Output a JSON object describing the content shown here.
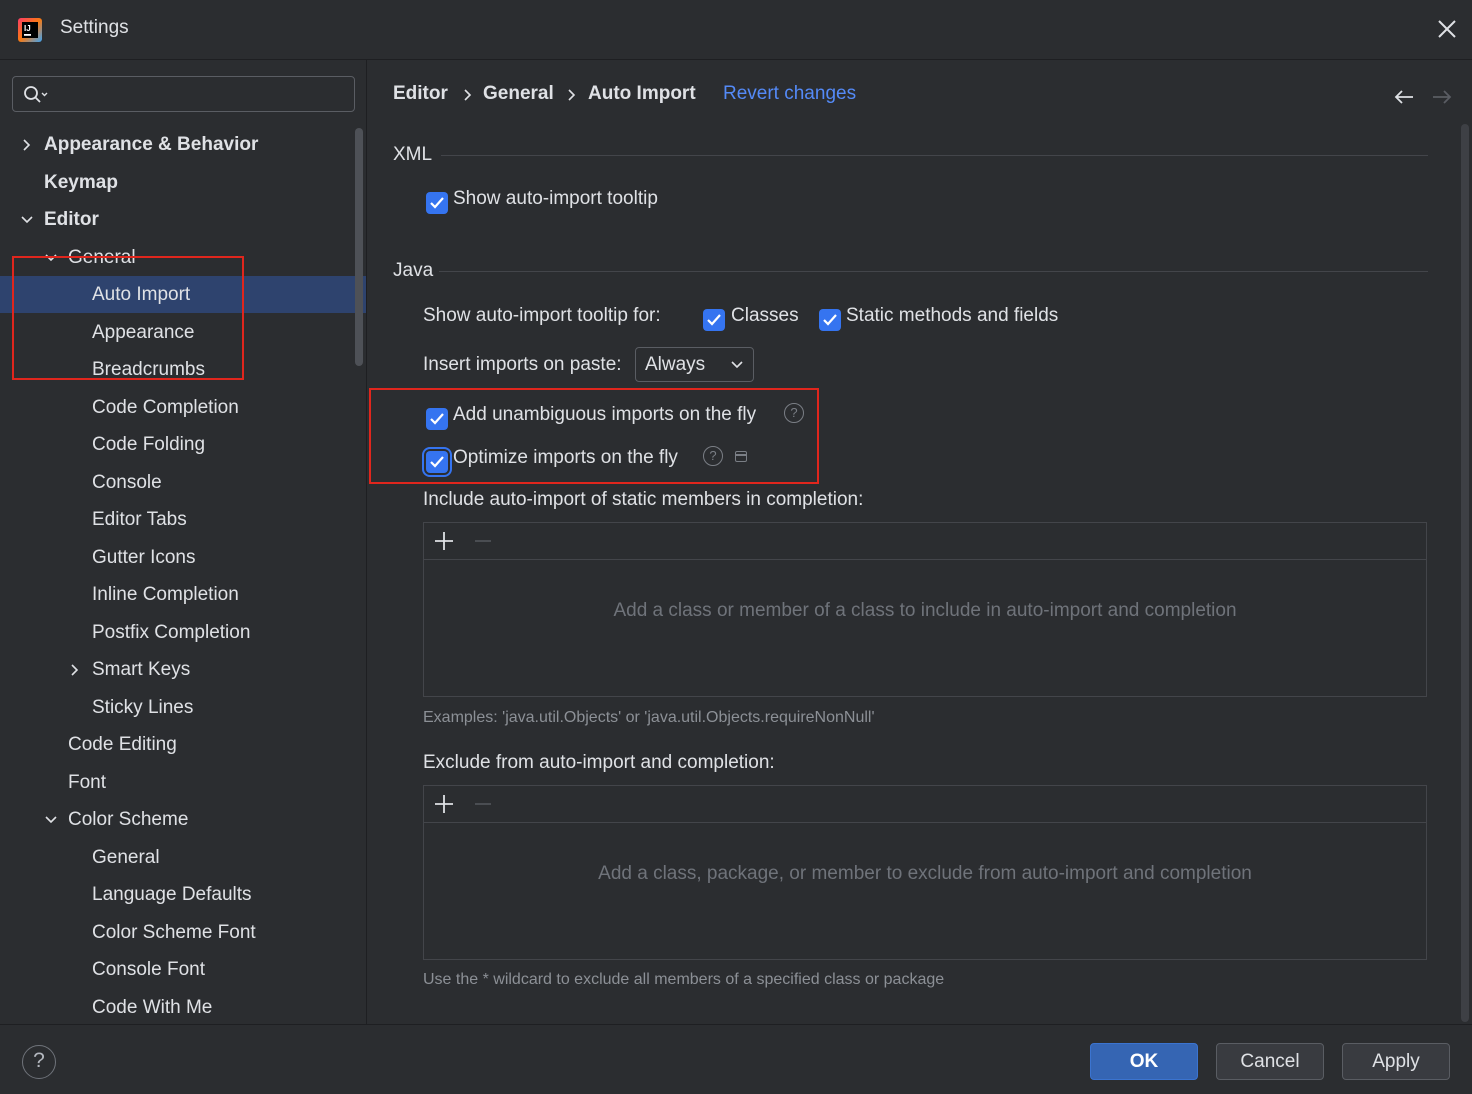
{
  "window": {
    "title": "Settings",
    "app_icon": "intellij-idea-icon",
    "close_icon": "close-icon"
  },
  "sidebar": {
    "search": {
      "placeholder": "",
      "value": ""
    },
    "items": [
      {
        "label": "Appearance & Behavior",
        "level": 0,
        "expandable": true,
        "expanded": false,
        "bold": true
      },
      {
        "label": "Keymap",
        "level": 0,
        "expandable": false,
        "bold": true
      },
      {
        "label": "Editor",
        "level": 0,
        "expandable": true,
        "expanded": true,
        "bold": true
      },
      {
        "label": "General",
        "level": 1,
        "expandable": true,
        "expanded": true
      },
      {
        "label": "Auto Import",
        "level": 2,
        "selected": true
      },
      {
        "label": "Appearance",
        "level": 2
      },
      {
        "label": "Breadcrumbs",
        "level": 2
      },
      {
        "label": "Code Completion",
        "level": 2
      },
      {
        "label": "Code Folding",
        "level": 2
      },
      {
        "label": "Console",
        "level": 2
      },
      {
        "label": "Editor Tabs",
        "level": 2
      },
      {
        "label": "Gutter Icons",
        "level": 2
      },
      {
        "label": "Inline Completion",
        "level": 2
      },
      {
        "label": "Postfix Completion",
        "level": 2
      },
      {
        "label": "Smart Keys",
        "level": 2,
        "expandable": true,
        "expanded": false
      },
      {
        "label": "Sticky Lines",
        "level": 2
      },
      {
        "label": "Code Editing",
        "level": 1
      },
      {
        "label": "Font",
        "level": 1
      },
      {
        "label": "Color Scheme",
        "level": 1,
        "expandable": true,
        "expanded": true
      },
      {
        "label": "General",
        "level": 2
      },
      {
        "label": "Language Defaults",
        "level": 2
      },
      {
        "label": "Color Scheme Font",
        "level": 2
      },
      {
        "label": "Console Font",
        "level": 2
      },
      {
        "label": "Code With Me",
        "level": 2
      }
    ]
  },
  "breadcrumb": {
    "items": [
      "Editor",
      "General",
      "Auto Import"
    ],
    "revert_label": "Revert changes"
  },
  "xml": {
    "title": "XML",
    "show_tooltip": {
      "label": "Show auto-import tooltip",
      "checked": true
    }
  },
  "java": {
    "title": "Java",
    "tooltip_for_label": "Show auto-import tooltip for:",
    "classes": {
      "label": "Classes",
      "checked": true
    },
    "static_methods": {
      "label": "Static methods and fields",
      "checked": true
    },
    "insert_on_paste_label": "Insert imports on paste:",
    "insert_on_paste_value": "Always",
    "add_unambiguous": {
      "label": "Add unambiguous imports on the fly",
      "checked": true
    },
    "optimize_imports": {
      "label": "Optimize imports on the fly",
      "checked": true
    },
    "include_title": "Include auto-import of static members in completion:",
    "include_empty": "Add a class or member of a class to include in auto-import and completion",
    "include_hint": "Examples: 'java.util.Objects' or 'java.util.Objects.requireNonNull'",
    "exclude_title": "Exclude from auto-import and completion:",
    "exclude_empty": "Add a class, package, or member to exclude from auto-import and completion",
    "exclude_hint": "Use the * wildcard to exclude all members of a specified class or package"
  },
  "footer": {
    "help_label": "?",
    "ok_label": "OK",
    "cancel_label": "Cancel",
    "apply_label": "Apply"
  },
  "colors": {
    "background": "#2b2d30",
    "selection": "#2e436e",
    "accent": "#3574f0",
    "link": "#548af7",
    "highlight_box": "#e0261d"
  }
}
